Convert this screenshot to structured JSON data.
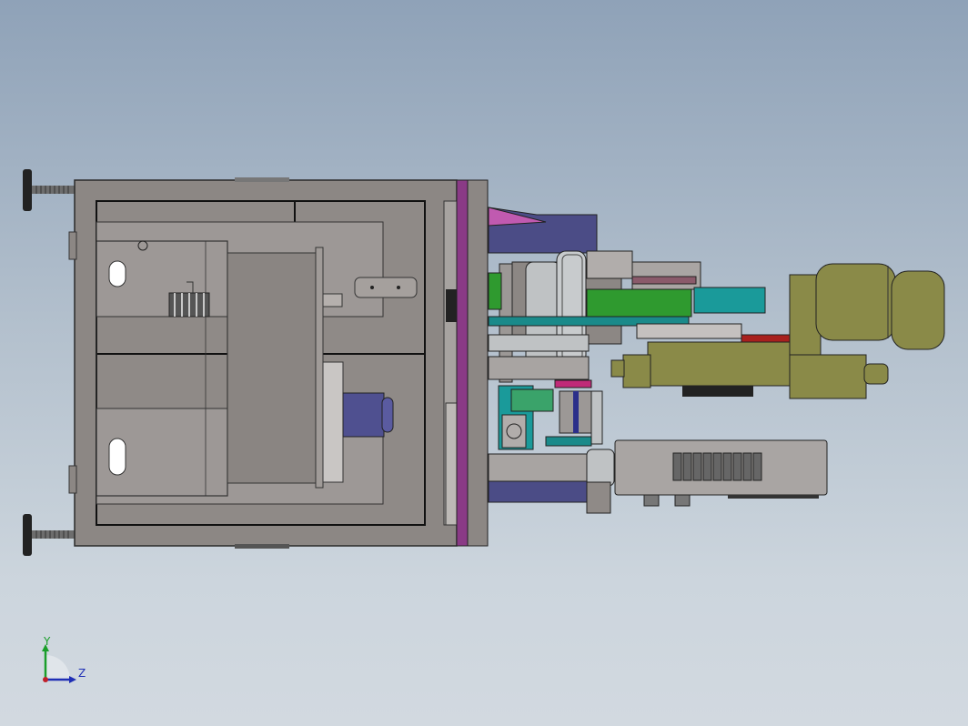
{
  "view": {
    "background_top": "#8fa2b8",
    "background_bottom": "#d2d9e0",
    "model": "machine-assembly-side-view"
  },
  "triad": {
    "y_label": "Y",
    "z_label": "Z",
    "y_color": "#1a9e2a",
    "z_color": "#1f2fb5",
    "origin_color": "#c0202a"
  },
  "colors": {
    "frame": "#8c8784",
    "plate": "#9d9896",
    "purple": "#8a3a86",
    "navy": "#4b4c86",
    "olive": "#8a8a48",
    "teal": "#1a9a9a",
    "green": "#2f9a2f",
    "magenta": "#c05ab0",
    "red": "#a8201e",
    "silver": "#bfc2c4"
  }
}
